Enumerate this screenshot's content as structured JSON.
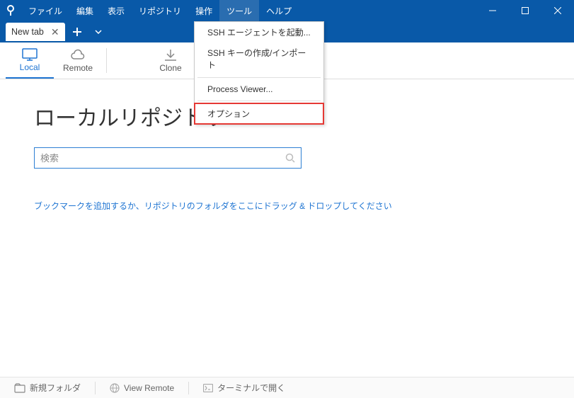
{
  "menu": {
    "file": "ファイル",
    "edit": "編集",
    "view": "表示",
    "repository": "リポジトリ",
    "action": "操作",
    "tools": "ツール",
    "help": "ヘルプ"
  },
  "tools_menu": {
    "ssh_agent": "SSH エージェントを起動...",
    "ssh_keys": "SSH キーの作成/インポート",
    "process_viewer": "Process Viewer...",
    "options": "オプション"
  },
  "tab": {
    "label": "New tab"
  },
  "toolbar": {
    "local": "Local",
    "remote": "Remote",
    "clone": "Clone"
  },
  "page": {
    "title": "ローカルリポジトリ",
    "search_placeholder": "検索",
    "hint": "ブックマークを追加するか、リポジトリのフォルダをここにドラッグ & ドロップしてください"
  },
  "status": {
    "new_folder": "新規フォルダ",
    "view_remote": "View Remote",
    "open_terminal": "ターミナルで開く"
  }
}
